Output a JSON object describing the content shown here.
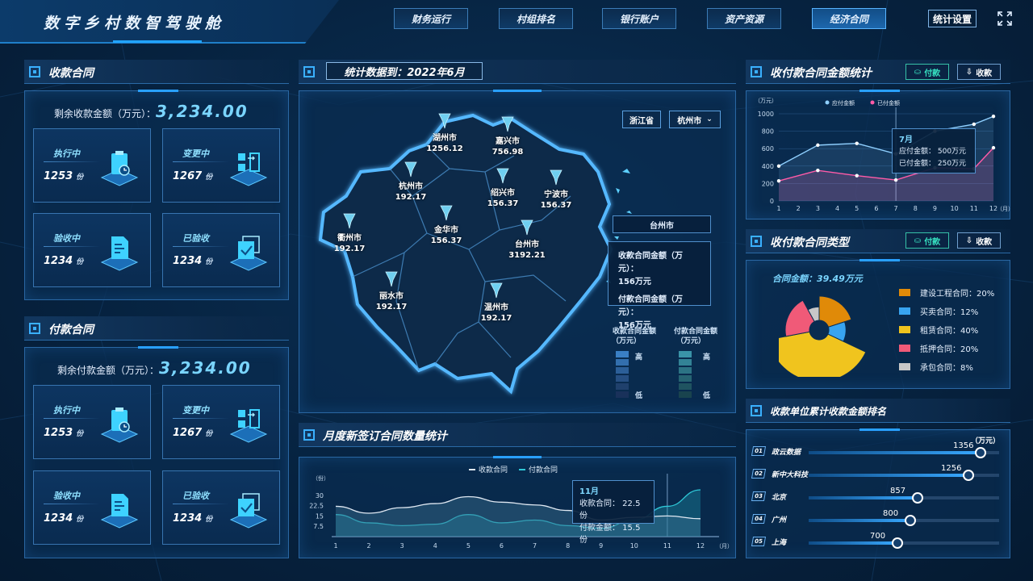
{
  "header": {
    "title": "数字乡村数智驾驶舱",
    "nav": [
      "财务运行",
      "村组排名",
      "银行账户",
      "资产资源",
      "经济合同"
    ],
    "active_nav": "经济合同",
    "settings": "统计设置"
  },
  "receive_contract": {
    "title": "收款合同",
    "remain_label": "剩余收款金额（万元）：",
    "remain_value": "3,234.00",
    "cards": [
      {
        "label": "执行中",
        "value": "1253",
        "unit": "份",
        "icon": "clipboard-clock-icon"
      },
      {
        "label": "变更中",
        "value": "1267",
        "unit": "份",
        "icon": "swap-blocks-icon"
      },
      {
        "label": "验收中",
        "value": "1234",
        "unit": "份",
        "icon": "document-check-icon"
      },
      {
        "label": "已验收",
        "value": "1234",
        "unit": "份",
        "icon": "stacked-check-icon"
      }
    ]
  },
  "pay_contract": {
    "title": "付款合同",
    "remain_label": "剩余付款金额（万元）：",
    "remain_value": "3,234.00",
    "cards": [
      {
        "label": "执行中",
        "value": "1253",
        "unit": "份",
        "icon": "clipboard-clock-icon"
      },
      {
        "label": "变更中",
        "value": "1267",
        "unit": "份",
        "icon": "swap-blocks-icon"
      },
      {
        "label": "验收中",
        "value": "1234",
        "unit": "份",
        "icon": "document-check-icon"
      },
      {
        "label": "已验收",
        "value": "1234",
        "unit": "份",
        "icon": "stacked-check-icon"
      }
    ]
  },
  "map_panel": {
    "stats_label": "统计数据到：2022年6月",
    "province": "浙江省",
    "city": "杭州市",
    "cities": [
      {
        "name": "湖州市",
        "value": "1256.12"
      },
      {
        "name": "嘉兴市",
        "value": "756.98"
      },
      {
        "name": "杭州市",
        "value": "192.17"
      },
      {
        "name": "绍兴市",
        "value": "156.37"
      },
      {
        "name": "宁波市",
        "value": "156.37"
      },
      {
        "name": "金华市",
        "value": "156.37"
      },
      {
        "name": "衢州市",
        "value": "192.17"
      },
      {
        "name": "台州市",
        "value": "3192.21"
      },
      {
        "name": "丽水市",
        "value": "192.17"
      },
      {
        "name": "温州市",
        "value": "192.17"
      }
    ],
    "tooltip": {
      "city": "台州市",
      "receive_label": "收款合同金额（万元）：",
      "receive_value": "156万元",
      "pay_label": "付款合同金额（万元）：",
      "pay_value": "156万元"
    },
    "legend": {
      "receive_title": "收款合同金额",
      "pay_title": "付款合同金额",
      "unit": "（万元）",
      "high": "高",
      "low": "低",
      "receive_colors": [
        "#3a7fc4",
        "#336fae",
        "#2c5f98",
        "#264f82",
        "#1f406c",
        "#19315a"
      ],
      "pay_colors": [
        "#3a93a8",
        "#338396",
        "#2c7384",
        "#266372",
        "#1f5360",
        "#19434e"
      ]
    }
  },
  "amount_chart": {
    "title": "收付款合同金额统计",
    "tabs": [
      "付款",
      "收款"
    ],
    "tab_icons": [
      "coin-icon",
      "download-icon"
    ],
    "tooltip": {
      "month": "7月",
      "line1": "应付金额：  500万元",
      "line2": "已付金额：  250万元"
    },
    "chart_data": {
      "type": "line",
      "ylabel": "（万元）",
      "xunit": "（月）",
      "x": [
        1,
        3,
        5,
        7,
        9,
        11,
        12
      ],
      "x_ticks": [
        1,
        2,
        3,
        4,
        5,
        6,
        7,
        8,
        9,
        10,
        11,
        12
      ],
      "ylim": [
        0,
        1000
      ],
      "yticks": [
        0,
        200,
        400,
        600,
        800,
        1000
      ],
      "series": [
        {
          "name": "应付金额",
          "color": "#8fd0ff",
          "values": [
            400,
            640,
            660,
            540,
            800,
            880,
            970
          ]
        },
        {
          "name": "已付金额",
          "color": "#ff5ba8",
          "values": [
            230,
            350,
            290,
            240,
            380,
            370,
            610
          ]
        }
      ]
    }
  },
  "type_chart": {
    "title": "收付款合同类型",
    "tabs": [
      "付款",
      "收款"
    ],
    "tab_icons": [
      "coin-icon",
      "download-icon"
    ],
    "total_label": "合同金额：39.49万元",
    "chart_data": {
      "type": "pie",
      "labels": [
        "建设工程合同",
        "买卖合同",
        "租赁合同",
        "抵押合同",
        "承包合同"
      ],
      "values": [
        20,
        12,
        40,
        20,
        8
      ],
      "colors": [
        "#e08a08",
        "#38a4f0",
        "#f0c41e",
        "#f05a78",
        "#c8c8c8"
      ]
    },
    "legend": [
      "建设工程合同：20%",
      "买卖合同：12%",
      "租赁合同：40%",
      "抵押合同：20%",
      "承包合同：8%"
    ]
  },
  "monthly_chart": {
    "title": "月度新签订合同数量统计",
    "tooltip": {
      "month": "11月",
      "line1": "收款合同：  22.5份",
      "line2": "付款金额：  15.5份"
    },
    "chart_data": {
      "type": "area",
      "ylabel": "（份）",
      "xunit": "（月）",
      "x": [
        1,
        2,
        3,
        4,
        5,
        6,
        7,
        8,
        9,
        10,
        11,
        12
      ],
      "ylim": [
        0,
        37.5
      ],
      "yticks": [
        7.5,
        15,
        22.5,
        30
      ],
      "series": [
        {
          "name": "收款合同",
          "color": "#dfe8f2",
          "values": [
            22,
            17,
            21,
            24,
            29,
            25,
            23,
            19,
            12,
            14,
            15,
            13
          ]
        },
        {
          "name": "付款合同",
          "color": "#2fc8d8",
          "values": [
            16,
            10,
            8,
            9,
            16,
            10,
            12,
            8,
            6,
            12,
            22,
            34
          ]
        }
      ]
    }
  },
  "ranking": {
    "title": "收款单位累计收款金额排名",
    "unit": "（万元）",
    "max": 1500,
    "rows": [
      {
        "no": "01",
        "name": "政云数据",
        "value": 1356
      },
      {
        "no": "02",
        "name": "新中大科技",
        "value": 1256
      },
      {
        "no": "03",
        "name": "北京",
        "value": 857
      },
      {
        "no": "04",
        "name": "广州",
        "value": 800
      },
      {
        "no": "05",
        "name": "上海",
        "value": 700
      }
    ]
  }
}
